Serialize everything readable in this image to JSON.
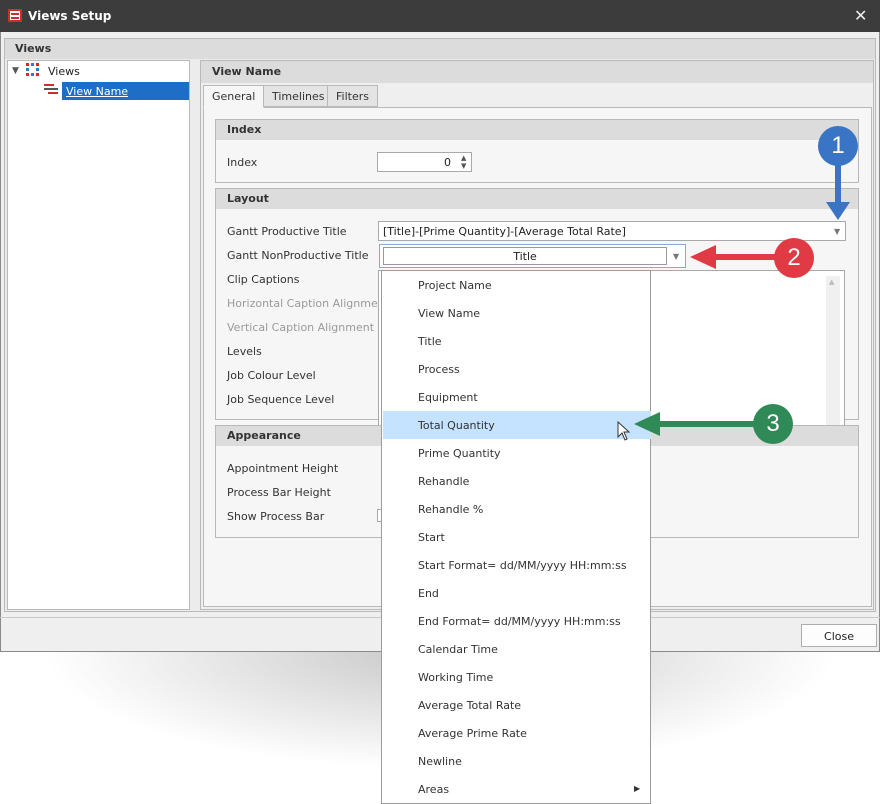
{
  "window": {
    "title": "Views Setup",
    "close_glyph": "✕"
  },
  "views_group": {
    "header": "Views"
  },
  "tree": {
    "root_label": "Views",
    "child_label": "View Name"
  },
  "panel": {
    "header": "View Name"
  },
  "tabs": [
    "General",
    "Timelines",
    "Filters"
  ],
  "index_group": {
    "header": "Index",
    "label": "Index",
    "value": "0"
  },
  "layout_group": {
    "header": "Layout",
    "labels": [
      "Gantt Productive Title",
      "Gantt NonProductive Title",
      "Clip Captions",
      "Horizontal Caption Alignment",
      "Vertical Caption Alignment",
      "Levels",
      "Job Colour Level",
      "Job Sequence Level"
    ],
    "productive_title_value": "[Title]-[Prime Quantity]-[Average Total Rate]",
    "nonproductive_title_value": "Title"
  },
  "appearance_group": {
    "header": "Appearance",
    "labels": [
      "Appointment Height",
      "Process Bar Height",
      "Show Process Bar"
    ]
  },
  "close_button": "Close",
  "dropdown": {
    "items": [
      "Project Name",
      "View Name",
      "Title",
      "Process",
      "Equipment",
      "Total Quantity",
      "Prime Quantity",
      "Rehandle",
      "Rehandle %",
      "Start",
      "Start Format= dd/MM/yyyy HH:mm:ss",
      "End",
      "End Format= dd/MM/yyyy HH:mm:ss",
      "Calendar Time",
      "Working Time",
      "Average Total Rate",
      "Average Prime Rate",
      "Newline",
      "Areas"
    ],
    "highlighted": "Total Quantity"
  },
  "annotations": {
    "badge1": "1",
    "badge2": "2",
    "badge3": "3",
    "color1": "#3a74c4",
    "color2": "#e03a45",
    "color3": "#2f8a57"
  }
}
